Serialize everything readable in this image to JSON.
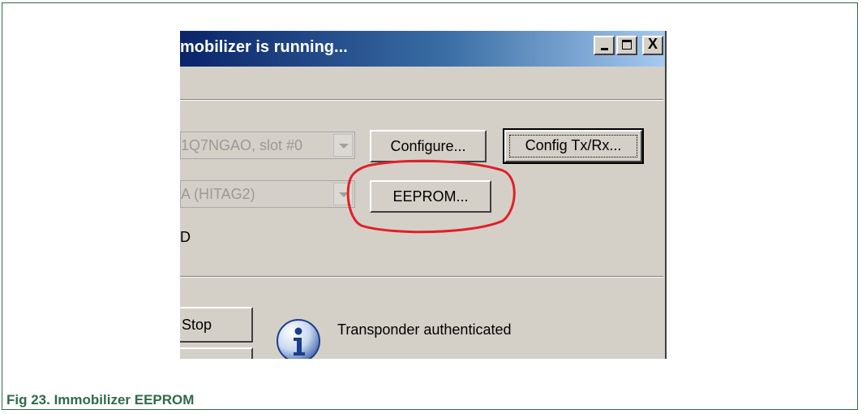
{
  "window": {
    "title": "mobilizer is running...",
    "close_glyph": "X"
  },
  "device_combo": {
    "value": "1Q7NGAO, slot #0"
  },
  "transponder_combo": {
    "value": "A (HITAG2)"
  },
  "buttons": {
    "configure": "Configure...",
    "config_txrx": "Config Tx/Rx...",
    "eeprom": "EEPROM...",
    "stop": "Stop"
  },
  "status_letter": "D",
  "status_message": "Transponder authenticated",
  "icons": [
    "info-icon",
    "dropdown-arrow-icon",
    "minimize-icon",
    "maximize-icon",
    "close-icon"
  ],
  "colors": {
    "highlight": "#e0202a",
    "caption": "#2e6b48",
    "title_bar": "#0a246a"
  },
  "caption": "Fig 23.   Immobilizer EEPROM"
}
